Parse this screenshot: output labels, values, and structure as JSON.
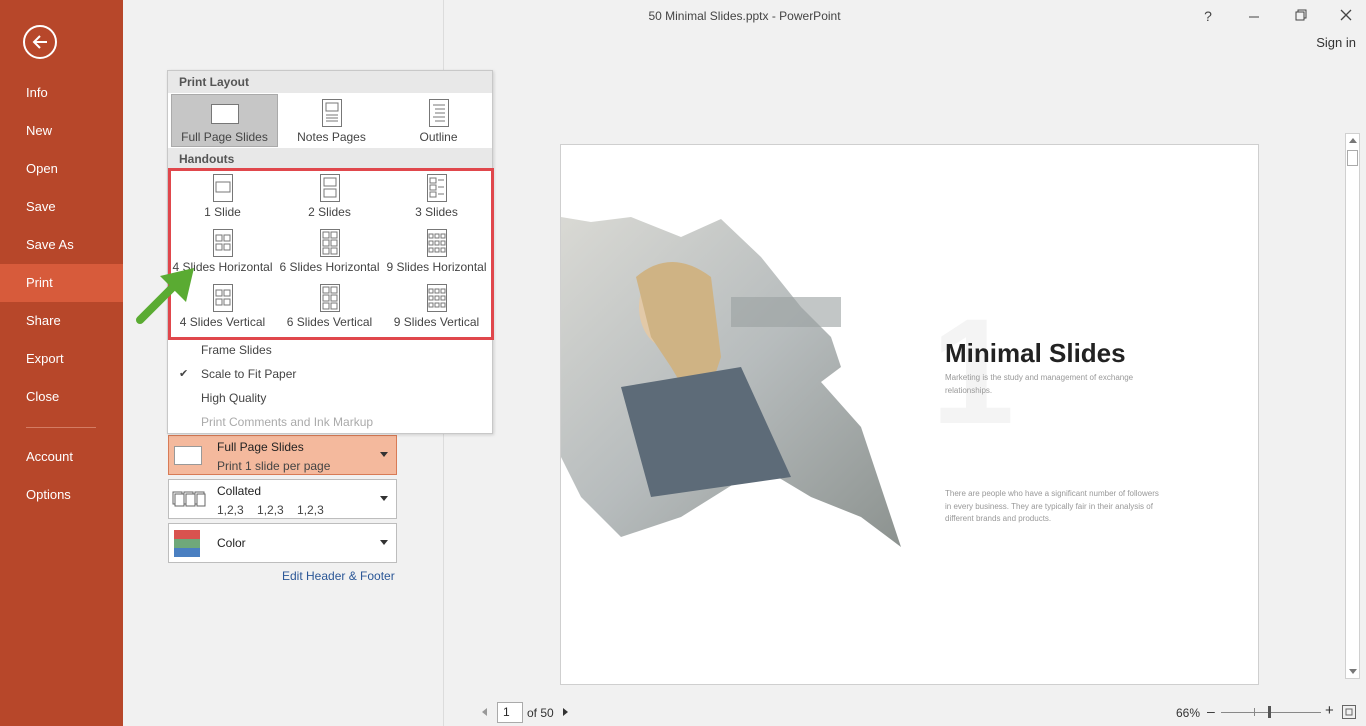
{
  "window": {
    "title": "50 Minimal Slides.pptx - PowerPoint",
    "help": "?",
    "signin": "Sign in"
  },
  "sidebar": {
    "items": [
      {
        "label": "Info",
        "active": false
      },
      {
        "label": "New",
        "active": false
      },
      {
        "label": "Open",
        "active": false
      },
      {
        "label": "Save",
        "active": false
      },
      {
        "label": "Save As",
        "active": false
      },
      {
        "label": "Print",
        "active": true
      },
      {
        "label": "Share",
        "active": false
      },
      {
        "label": "Export",
        "active": false
      },
      {
        "label": "Close",
        "active": false
      }
    ],
    "bottom_items": [
      {
        "label": "Account"
      },
      {
        "label": "Options"
      }
    ],
    "color": "#b7472a",
    "active_color": "#d75b3b"
  },
  "dropdown": {
    "print_layout_header": "Print Layout",
    "layouts": [
      {
        "label": "Full Page Slides",
        "selected": true
      },
      {
        "label": "Notes Pages",
        "selected": false
      },
      {
        "label": "Outline",
        "selected": false
      }
    ],
    "handouts_header": "Handouts",
    "handouts": [
      {
        "label": "1 Slide"
      },
      {
        "label": "2 Slides"
      },
      {
        "label": "3 Slides"
      },
      {
        "label": "4 Slides Horizontal"
      },
      {
        "label": "6 Slides Horizontal"
      },
      {
        "label": "9 Slides Horizontal"
      },
      {
        "label": "4 Slides Vertical"
      },
      {
        "label": "6 Slides Vertical"
      },
      {
        "label": "9 Slides Vertical"
      }
    ],
    "options": [
      {
        "label": "Frame Slides",
        "checked": false,
        "disabled": false
      },
      {
        "label": "Scale to Fit Paper",
        "checked": true,
        "disabled": false
      },
      {
        "label": "High Quality",
        "checked": false,
        "disabled": false
      },
      {
        "label": "Print Comments and Ink Markup",
        "checked": false,
        "disabled": true
      }
    ]
  },
  "settings": {
    "layout": {
      "title": "Full Page Slides",
      "subtitle": "Print 1 slide per page"
    },
    "collation": {
      "title": "Collated",
      "subtitle": "1,2,3    1,2,3    1,2,3"
    },
    "color": {
      "title": "Color"
    },
    "edit_link": "Edit Header & Footer"
  },
  "slide": {
    "title": "Minimal Slides",
    "subtitle": "Marketing is the study and management of exchange relationships.",
    "body": "There are people  who have a significant number of followers  in every business. They are typically fair in their analysis of different brands and products.",
    "big_number": "1"
  },
  "navigation": {
    "page": "1",
    "of_label": "of 50",
    "zoom": "66%"
  },
  "colors": {
    "highlight_box": "#e0474c",
    "arrow": "#5aab32",
    "selected_setting": "#f4b99d"
  }
}
